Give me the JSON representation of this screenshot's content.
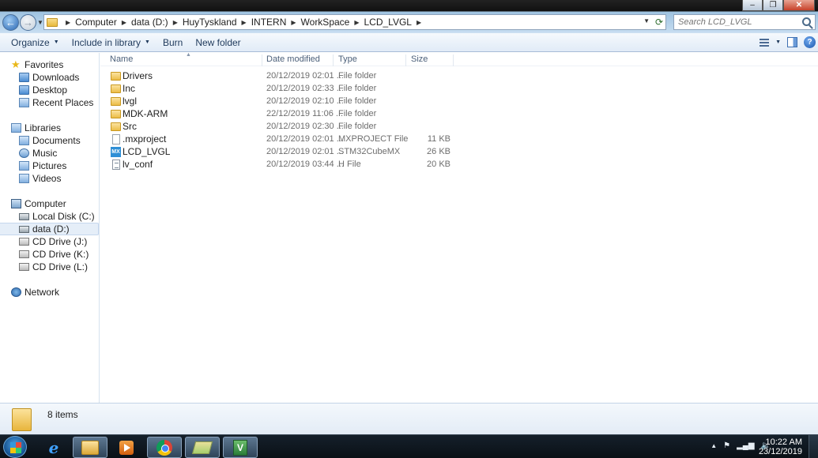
{
  "address": {
    "crumbs": [
      "Computer",
      "data (D:)",
      "HuyTyskland",
      "INTERN",
      "WorkSpace",
      "LCD_LVGL"
    ]
  },
  "search": {
    "placeholder": "Search LCD_LVGL"
  },
  "toolbar": {
    "organize": "Organize",
    "include_in_library": "Include in library",
    "burn": "Burn",
    "new_folder": "New folder"
  },
  "nav": {
    "favorites": {
      "label": "Favorites",
      "items": [
        "Downloads",
        "Desktop",
        "Recent Places"
      ]
    },
    "libraries": {
      "label": "Libraries",
      "items": [
        "Documents",
        "Music",
        "Pictures",
        "Videos"
      ]
    },
    "computer": {
      "label": "Computer",
      "items": [
        "Local Disk (C:)",
        "data (D:)",
        "CD Drive (J:)",
        "CD Drive (K:)",
        "CD Drive (L:)"
      ]
    },
    "network": {
      "label": "Network"
    }
  },
  "columns": {
    "name": "Name",
    "date": "Date modified",
    "type": "Type",
    "size": "Size"
  },
  "files": [
    {
      "name": "Drivers",
      "date": "20/12/2019 02:01 ...",
      "type": "File folder",
      "size": "",
      "icon": "folder-icon"
    },
    {
      "name": "Inc",
      "date": "20/12/2019 02:33 ...",
      "type": "File folder",
      "size": "",
      "icon": "folder-icon"
    },
    {
      "name": "lvgl",
      "date": "20/12/2019 02:10 ...",
      "type": "File folder",
      "size": "",
      "icon": "folder-icon"
    },
    {
      "name": "MDK-ARM",
      "date": "22/12/2019 11:06 ...",
      "type": "File folder",
      "size": "",
      "icon": "folder-icon"
    },
    {
      "name": "Src",
      "date": "20/12/2019 02:30 ...",
      "type": "File folder",
      "size": "",
      "icon": "folder-icon"
    },
    {
      "name": ".mxproject",
      "date": "20/12/2019 02:01 ...",
      "type": "MXPROJECT File",
      "size": "11 KB",
      "icon": "document-icon"
    },
    {
      "name": "LCD_LVGL",
      "date": "20/12/2019 02:01 ...",
      "type": "STM32CubeMX",
      "size": "26 KB",
      "icon": "stm32cubemx-icon"
    },
    {
      "name": "lv_conf",
      "date": "20/12/2019 03:44 ...",
      "type": "H File",
      "size": "20 KB",
      "icon": "header-file-icon"
    }
  ],
  "details": {
    "item_count": "8 items"
  },
  "taskbar": {
    "time": "10:22 AM",
    "date": "23/12/2019"
  }
}
